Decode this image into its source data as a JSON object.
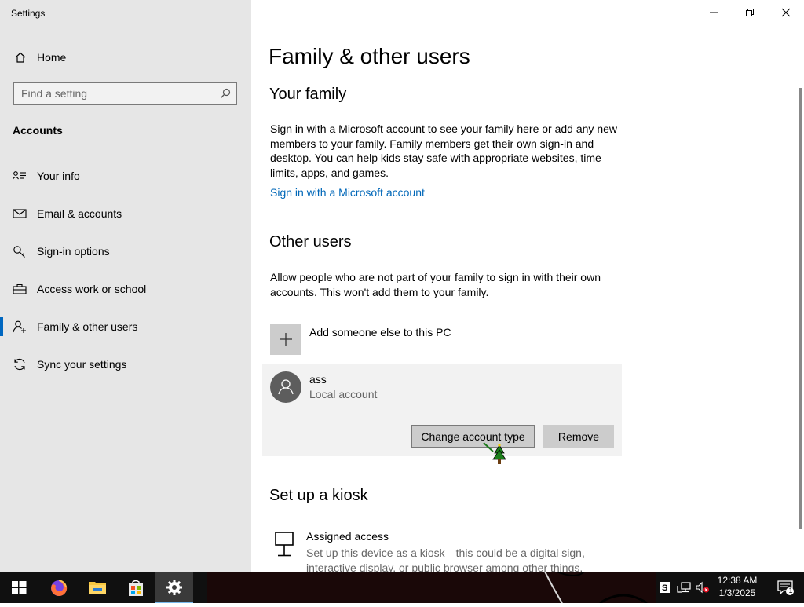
{
  "app": {
    "title": "Settings"
  },
  "sidebar": {
    "home_label": "Home",
    "search_placeholder": "Find a setting",
    "section_label": "Accounts",
    "items": [
      {
        "label": "Your info",
        "icon": "contact-card-icon"
      },
      {
        "label": "Email & accounts",
        "icon": "mail-icon"
      },
      {
        "label": "Sign-in options",
        "icon": "key-icon"
      },
      {
        "label": "Access work or school",
        "icon": "briefcase-icon"
      },
      {
        "label": "Family & other users",
        "icon": "add-person-icon",
        "active": true
      },
      {
        "label": "Sync your settings",
        "icon": "sync-icon"
      }
    ]
  },
  "main": {
    "title": "Family & other users",
    "family": {
      "heading": "Your family",
      "description": "Sign in with a Microsoft account to see your family here or add any new members to your family. Family members get their own sign-in and desktop. You can help kids stay safe with appropriate websites, time limits, apps, and games.",
      "link": "Sign in with a Microsoft account"
    },
    "other_users": {
      "heading": "Other users",
      "description": "Allow people who are not part of your family to sign in with their own accounts. This won't add them to your family.",
      "add_label": "Add someone else to this PC",
      "user": {
        "name": "ass",
        "type": "Local account",
        "change_button": "Change account type",
        "remove_button": "Remove"
      }
    },
    "kiosk": {
      "heading": "Set up a kiosk",
      "title": "Assigned access",
      "description": "Set up this device as a kiosk—this could be a digital sign, interactive display, or public browser among other things."
    }
  },
  "taskbar": {
    "time": "12:38 AM",
    "date": "1/3/2025",
    "notification_count": "1",
    "accent_color": "#76b9ed"
  }
}
